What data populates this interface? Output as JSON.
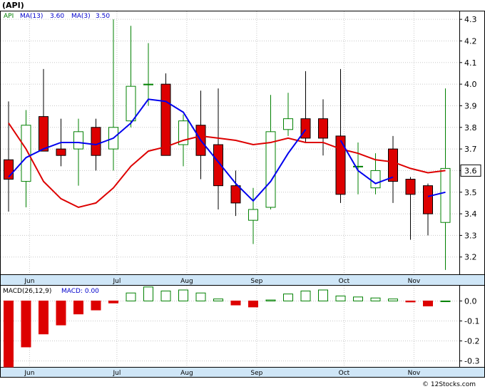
{
  "header": {
    "ticker": "(API)",
    "legend": [
      {
        "text": "API",
        "color": "#008000"
      },
      {
        "text": "MA(13)",
        "color": "#0000cc"
      },
      {
        "text": "3.60",
        "color": "#0000cc"
      },
      {
        "text": "MA(3)",
        "color": "#0000cc"
      },
      {
        "text": "3.50",
        "color": "#0000cc"
      }
    ]
  },
  "watermark": "© 12Stocks.com",
  "colors": {
    "up": "#008000",
    "down": "#dd0000",
    "ma_long": "#dd0000",
    "ma_short": "#0000ee",
    "axis_bg": "#cfe6f7"
  },
  "chart_data": [
    {
      "type": "candlestick",
      "price_ticks": [
        3.2,
        3.3,
        3.4,
        3.5,
        3.6,
        3.7,
        3.8,
        3.9,
        4.0,
        4.1,
        4.2,
        4.3
      ],
      "price_tick_labels": [
        "3.2",
        "3.3",
        "3.4",
        "3.5",
        "3.6",
        "3.7",
        "3.8",
        "3.9",
        "4.0",
        "4.1",
        "4.2",
        "4.3"
      ],
      "ylim": [
        3.12,
        4.34
      ],
      "last_price_label": "3.6",
      "last_price": 3.6,
      "month_labels": [
        {
          "label": "Jun",
          "at": 1.2
        },
        {
          "label": "Jul",
          "at": 6.2
        },
        {
          "label": "Aug",
          "at": 10.2
        },
        {
          "label": "Sep",
          "at": 14.2
        },
        {
          "label": "Oct",
          "at": 19.2
        },
        {
          "label": "Nov",
          "at": 23.2
        }
      ],
      "candles": [
        {
          "o": 3.65,
          "h": 3.92,
          "l": 3.41,
          "c": 3.56
        },
        {
          "o": 3.55,
          "h": 3.88,
          "l": 3.43,
          "c": 3.81
        },
        {
          "o": 3.85,
          "h": 4.07,
          "l": 3.7,
          "c": 3.69
        },
        {
          "o": 3.7,
          "h": 3.84,
          "l": 3.62,
          "c": 3.67
        },
        {
          "o": 3.7,
          "h": 3.84,
          "l": 3.53,
          "c": 3.78
        },
        {
          "o": 3.8,
          "h": 3.84,
          "l": 3.6,
          "c": 3.67
        },
        {
          "o": 3.7,
          "h": 4.3,
          "l": 3.6,
          "c": 3.8
        },
        {
          "o": 3.83,
          "h": 4.27,
          "l": 3.8,
          "c": 3.99
        },
        {
          "o": 4.0,
          "h": 4.19,
          "l": 3.9,
          "c": 4.0
        },
        {
          "o": 4.0,
          "h": 4.05,
          "l": 3.67,
          "c": 3.67
        },
        {
          "o": 3.72,
          "h": 3.86,
          "l": 3.62,
          "c": 3.83
        },
        {
          "o": 3.81,
          "h": 3.97,
          "l": 3.56,
          "c": 3.67
        },
        {
          "o": 3.72,
          "h": 3.98,
          "l": 3.42,
          "c": 3.53
        },
        {
          "o": 3.53,
          "h": 3.6,
          "l": 3.39,
          "c": 3.45
        },
        {
          "o": 3.37,
          "h": 3.52,
          "l": 3.26,
          "c": 3.42
        },
        {
          "o": 3.43,
          "h": 3.95,
          "l": 3.42,
          "c": 3.78
        },
        {
          "o": 3.79,
          "h": 3.96,
          "l": 3.76,
          "c": 3.84
        },
        {
          "o": 3.84,
          "h": 4.06,
          "l": 3.73,
          "c": 3.75
        },
        {
          "o": 3.84,
          "h": 3.93,
          "l": 3.67,
          "c": 3.75
        },
        {
          "o": 3.76,
          "h": 4.07,
          "l": 3.45,
          "c": 3.49
        },
        {
          "o": 3.62,
          "h": 3.73,
          "l": 3.49,
          "c": 3.62
        },
        {
          "o": 3.52,
          "h": 3.68,
          "l": 3.49,
          "c": 3.6
        },
        {
          "o": 3.7,
          "h": 3.76,
          "l": 3.45,
          "c": 3.55
        },
        {
          "o": 3.56,
          "h": 3.57,
          "l": 3.28,
          "c": 3.49
        },
        {
          "o": 3.53,
          "h": 3.54,
          "l": 3.3,
          "c": 3.4
        },
        {
          "o": 3.36,
          "h": 3.98,
          "l": 3.14,
          "c": 3.61
        }
      ],
      "series": [
        {
          "name": "MA(13)",
          "color": "#dd0000",
          "values": [
            3.82,
            3.7,
            3.55,
            3.47,
            3.43,
            3.45,
            3.52,
            3.62,
            3.69,
            3.71,
            3.74,
            3.76,
            3.75,
            3.74,
            3.72,
            3.73,
            3.75,
            3.73,
            3.73,
            3.7,
            3.68,
            3.65,
            3.64,
            3.61,
            3.59,
            3.6
          ]
        },
        {
          "name": "MA(3)",
          "color": "#0000ee",
          "values": [
            3.57,
            3.66,
            3.7,
            3.73,
            3.73,
            3.72,
            3.75,
            3.82,
            3.93,
            3.92,
            3.87,
            3.74,
            3.64,
            3.54,
            3.46,
            3.55,
            3.68,
            3.79,
            null,
            3.74,
            3.6,
            3.54,
            3.57,
            null,
            3.48,
            3.5
          ]
        }
      ]
    },
    {
      "type": "bar",
      "title": "MACD(26,12,9)",
      "value_label": "MACD: 0.00",
      "yticks": [
        0.0,
        -0.1,
        -0.2,
        -0.3
      ],
      "ytick_labels": [
        "0.0",
        "-0.1",
        "-0.2",
        "-0.3"
      ],
      "ylim": [
        -0.33,
        0.08
      ],
      "values": [
        -0.33,
        -0.23,
        -0.165,
        -0.12,
        -0.065,
        -0.045,
        -0.01,
        0.04,
        0.07,
        0.05,
        0.055,
        0.04,
        0.01,
        -0.02,
        -0.03,
        0.005,
        0.035,
        0.05,
        0.055,
        0.025,
        0.02,
        0.015,
        0.01,
        -0.005,
        -0.025,
        0.0
      ]
    }
  ]
}
